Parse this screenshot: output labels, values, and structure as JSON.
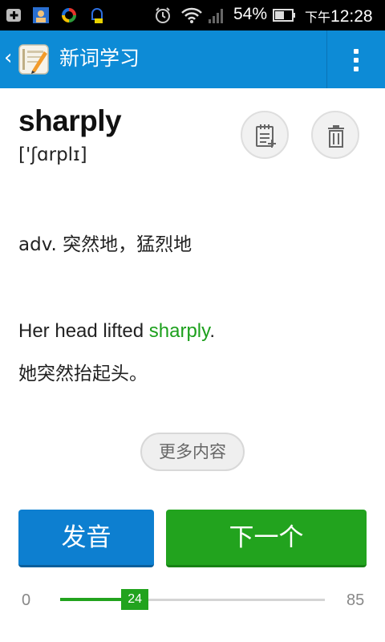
{
  "status_bar": {
    "battery_percent": "54%",
    "time_prefix": "下午",
    "time": "12:28",
    "icons": [
      "add-box-icon",
      "contacts-icon",
      "sync-icon",
      "notification-app-icon",
      "alarm-icon",
      "wifi-icon",
      "signal-icon",
      "battery-icon"
    ]
  },
  "app_bar": {
    "back_symbol": "‹",
    "title": "新词学习",
    "logo_icon": "word-notebook-icon",
    "menu_icon": "overflow-menu-icon"
  },
  "word": {
    "headword": "sharply",
    "phonetic": "['ʃɑrplɪ]",
    "definition": "adv. 突然地，猛烈地",
    "example_en_before": "Her head lifted ",
    "example_en_highlight": "sharply",
    "example_en_after": ".",
    "example_zh": "她突然抬起头。",
    "highlight_color": "#1da01d"
  },
  "actions": {
    "add_to_notebook_icon": "add-note-icon",
    "delete_icon": "trash-icon",
    "more_label": "更多内容",
    "pronounce_label": "发音",
    "next_label": "下一个"
  },
  "progress": {
    "min": "0",
    "max": "85",
    "current": "24",
    "value": 24,
    "total": 85
  },
  "colors": {
    "app_bar": "#0d8bd6",
    "pronounce_button": "#0d7fd0",
    "next_button": "#22a31e"
  }
}
